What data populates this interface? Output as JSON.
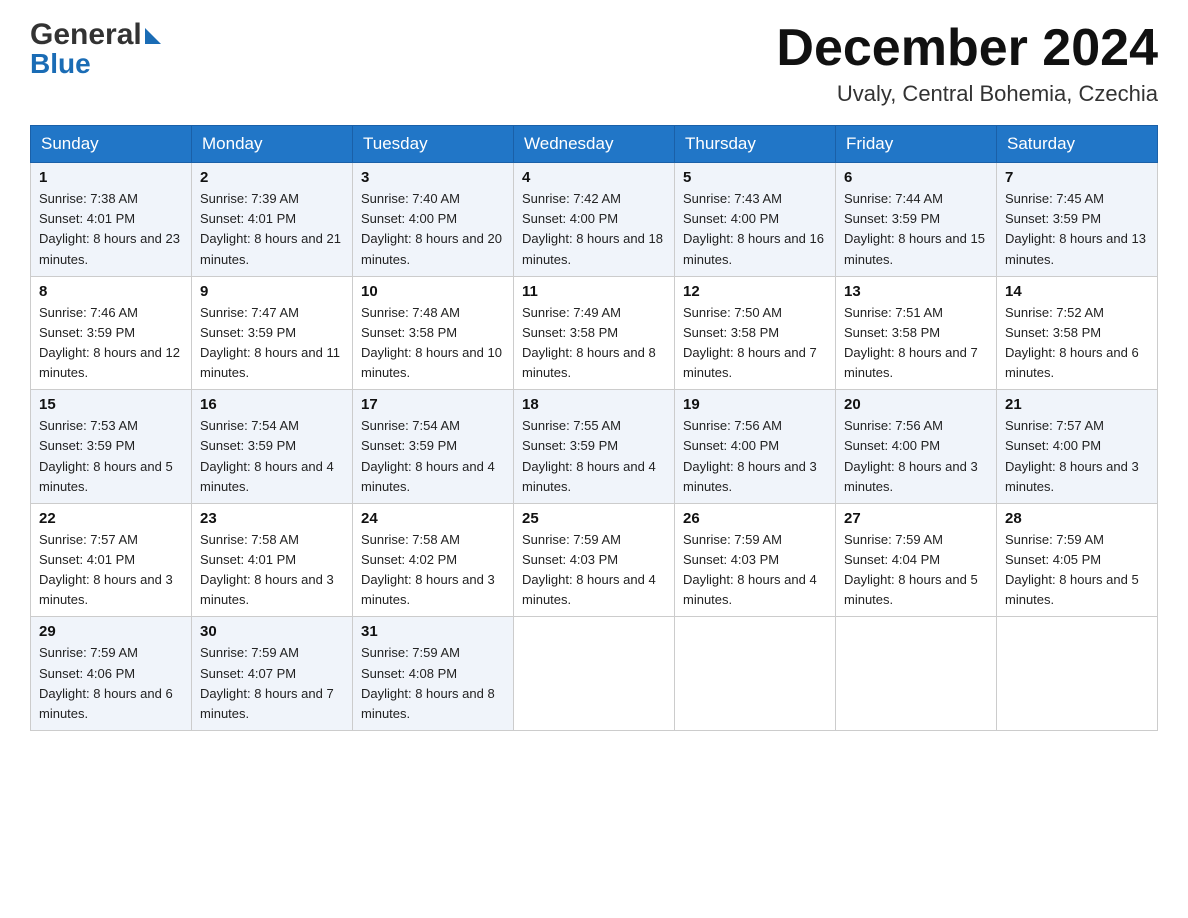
{
  "header": {
    "logo_general": "General",
    "logo_blue": "Blue",
    "month_year": "December 2024",
    "location": "Uvaly, Central Bohemia, Czechia"
  },
  "weekdays": [
    "Sunday",
    "Monday",
    "Tuesday",
    "Wednesday",
    "Thursday",
    "Friday",
    "Saturday"
  ],
  "weeks": [
    [
      {
        "day": "1",
        "sunrise": "7:38 AM",
        "sunset": "4:01 PM",
        "daylight": "8 hours and 23 minutes."
      },
      {
        "day": "2",
        "sunrise": "7:39 AM",
        "sunset": "4:01 PM",
        "daylight": "8 hours and 21 minutes."
      },
      {
        "day": "3",
        "sunrise": "7:40 AM",
        "sunset": "4:00 PM",
        "daylight": "8 hours and 20 minutes."
      },
      {
        "day": "4",
        "sunrise": "7:42 AM",
        "sunset": "4:00 PM",
        "daylight": "8 hours and 18 minutes."
      },
      {
        "day": "5",
        "sunrise": "7:43 AM",
        "sunset": "4:00 PM",
        "daylight": "8 hours and 16 minutes."
      },
      {
        "day": "6",
        "sunrise": "7:44 AM",
        "sunset": "3:59 PM",
        "daylight": "8 hours and 15 minutes."
      },
      {
        "day": "7",
        "sunrise": "7:45 AM",
        "sunset": "3:59 PM",
        "daylight": "8 hours and 13 minutes."
      }
    ],
    [
      {
        "day": "8",
        "sunrise": "7:46 AM",
        "sunset": "3:59 PM",
        "daylight": "8 hours and 12 minutes."
      },
      {
        "day": "9",
        "sunrise": "7:47 AM",
        "sunset": "3:59 PM",
        "daylight": "8 hours and 11 minutes."
      },
      {
        "day": "10",
        "sunrise": "7:48 AM",
        "sunset": "3:58 PM",
        "daylight": "8 hours and 10 minutes."
      },
      {
        "day": "11",
        "sunrise": "7:49 AM",
        "sunset": "3:58 PM",
        "daylight": "8 hours and 8 minutes."
      },
      {
        "day": "12",
        "sunrise": "7:50 AM",
        "sunset": "3:58 PM",
        "daylight": "8 hours and 7 minutes."
      },
      {
        "day": "13",
        "sunrise": "7:51 AM",
        "sunset": "3:58 PM",
        "daylight": "8 hours and 7 minutes."
      },
      {
        "day": "14",
        "sunrise": "7:52 AM",
        "sunset": "3:58 PM",
        "daylight": "8 hours and 6 minutes."
      }
    ],
    [
      {
        "day": "15",
        "sunrise": "7:53 AM",
        "sunset": "3:59 PM",
        "daylight": "8 hours and 5 minutes."
      },
      {
        "day": "16",
        "sunrise": "7:54 AM",
        "sunset": "3:59 PM",
        "daylight": "8 hours and 4 minutes."
      },
      {
        "day": "17",
        "sunrise": "7:54 AM",
        "sunset": "3:59 PM",
        "daylight": "8 hours and 4 minutes."
      },
      {
        "day": "18",
        "sunrise": "7:55 AM",
        "sunset": "3:59 PM",
        "daylight": "8 hours and 4 minutes."
      },
      {
        "day": "19",
        "sunrise": "7:56 AM",
        "sunset": "4:00 PM",
        "daylight": "8 hours and 3 minutes."
      },
      {
        "day": "20",
        "sunrise": "7:56 AM",
        "sunset": "4:00 PM",
        "daylight": "8 hours and 3 minutes."
      },
      {
        "day": "21",
        "sunrise": "7:57 AM",
        "sunset": "4:00 PM",
        "daylight": "8 hours and 3 minutes."
      }
    ],
    [
      {
        "day": "22",
        "sunrise": "7:57 AM",
        "sunset": "4:01 PM",
        "daylight": "8 hours and 3 minutes."
      },
      {
        "day": "23",
        "sunrise": "7:58 AM",
        "sunset": "4:01 PM",
        "daylight": "8 hours and 3 minutes."
      },
      {
        "day": "24",
        "sunrise": "7:58 AM",
        "sunset": "4:02 PM",
        "daylight": "8 hours and 3 minutes."
      },
      {
        "day": "25",
        "sunrise": "7:59 AM",
        "sunset": "4:03 PM",
        "daylight": "8 hours and 4 minutes."
      },
      {
        "day": "26",
        "sunrise": "7:59 AM",
        "sunset": "4:03 PM",
        "daylight": "8 hours and 4 minutes."
      },
      {
        "day": "27",
        "sunrise": "7:59 AM",
        "sunset": "4:04 PM",
        "daylight": "8 hours and 5 minutes."
      },
      {
        "day": "28",
        "sunrise": "7:59 AM",
        "sunset": "4:05 PM",
        "daylight": "8 hours and 5 minutes."
      }
    ],
    [
      {
        "day": "29",
        "sunrise": "7:59 AM",
        "sunset": "4:06 PM",
        "daylight": "8 hours and 6 minutes."
      },
      {
        "day": "30",
        "sunrise": "7:59 AM",
        "sunset": "4:07 PM",
        "daylight": "8 hours and 7 minutes."
      },
      {
        "day": "31",
        "sunrise": "7:59 AM",
        "sunset": "4:08 PM",
        "daylight": "8 hours and 8 minutes."
      },
      null,
      null,
      null,
      null
    ]
  ],
  "colors": {
    "header_bg": "#2176c7",
    "accent_blue": "#1a6cb5"
  }
}
